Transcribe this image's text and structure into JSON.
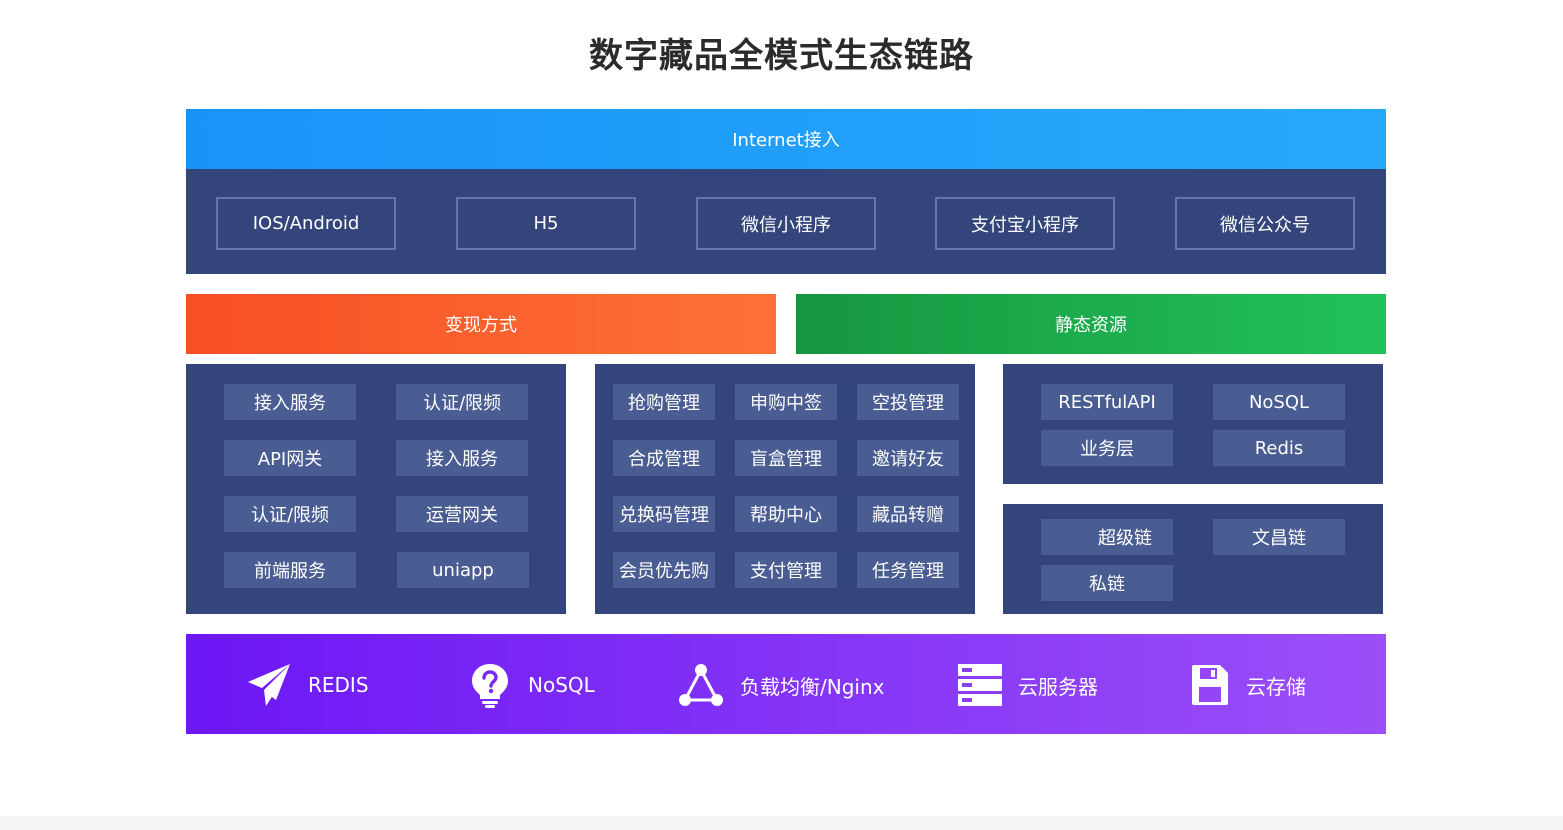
{
  "title": "数字藏品全模式生态链路",
  "access": {
    "banner": "Internet接入",
    "clients": [
      "IOS/Android",
      "H5",
      "微信小程序",
      "支付宝小程序",
      "微信公众号"
    ]
  },
  "monetization": {
    "banner": "变现方式"
  },
  "static_resources": {
    "banner": "静态资源"
  },
  "services_panel": {
    "items": [
      "接入服务",
      "认证/限频",
      "API网关",
      "接入服务",
      "认证/限频",
      "运营网关",
      "前端服务",
      "uniapp"
    ]
  },
  "business_panel": {
    "items": [
      "抢购管理",
      "申购中签",
      "空投管理",
      "合成管理",
      "盲盒管理",
      "邀请好友",
      "兑换码管理",
      "帮助中心",
      "藏品转赠",
      "会员优先购",
      "支付管理",
      "任务管理"
    ]
  },
  "api_panel": {
    "items": [
      "RESTfulAPI",
      "NoSQL",
      "业务层",
      "Redis"
    ]
  },
  "chain_panel": {
    "items": [
      "超级链",
      "文昌链",
      "私链"
    ]
  },
  "infrastructure": {
    "items": [
      {
        "label": "REDIS",
        "icon": "paper-plane-icon"
      },
      {
        "label": "NoSQL",
        "icon": "lightbulb-question-icon"
      },
      {
        "label": "负载均衡/Nginx",
        "icon": "network-triangle-icon"
      },
      {
        "label": "云服务器",
        "icon": "server-rack-icon"
      },
      {
        "label": "云存储",
        "icon": "floppy-disk-icon"
      }
    ]
  },
  "colors": {
    "panel": "#33457b",
    "chip": "#4a5d93",
    "internet": "#1a93f7",
    "monetization": "#f74f24",
    "static": "#22c15c",
    "infrastructure": "#6c17f5"
  }
}
